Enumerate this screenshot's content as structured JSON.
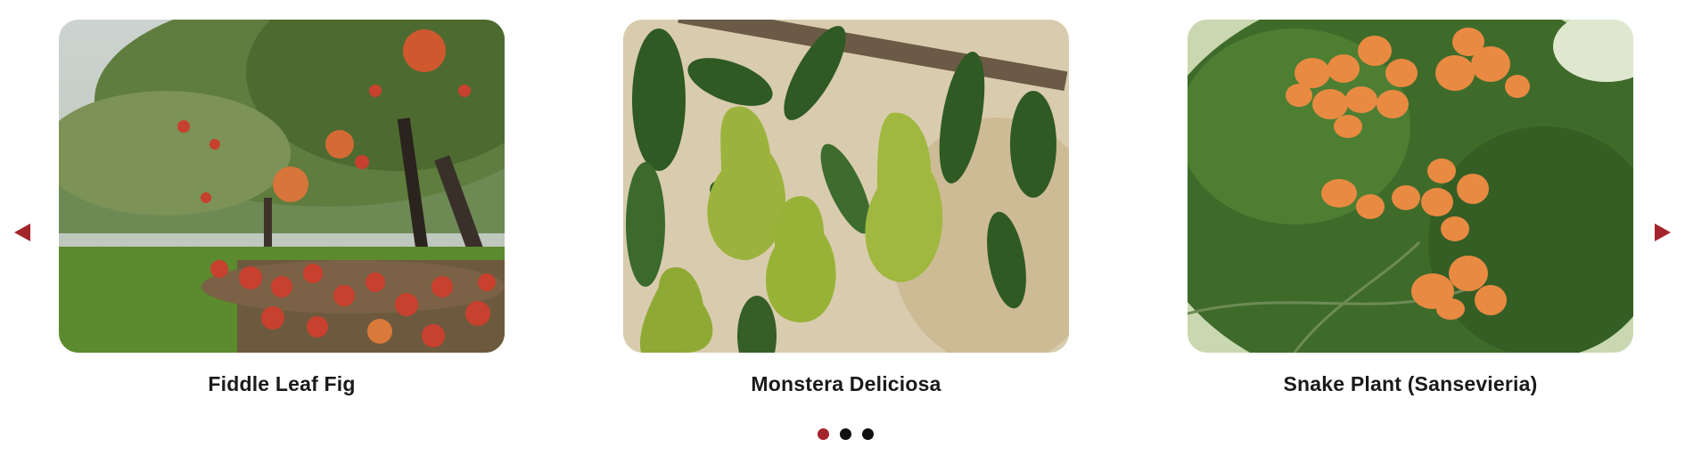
{
  "colors": {
    "accent": "#a3242b",
    "dot_inactive": "#111111"
  },
  "carousel": {
    "prev_icon": "triangle-left-icon",
    "next_icon": "triangle-right-icon",
    "active_index": 0,
    "slides": [
      {
        "caption": "Fiddle Leaf Fig",
        "image": "apple-orchard-photo"
      },
      {
        "caption": "Monstera Deliciosa",
        "image": "green-pears-photo"
      },
      {
        "caption": "Snake Plant (Sansevieria)",
        "image": "orange-fruit-tree-photo"
      }
    ],
    "dot_count": 3
  }
}
